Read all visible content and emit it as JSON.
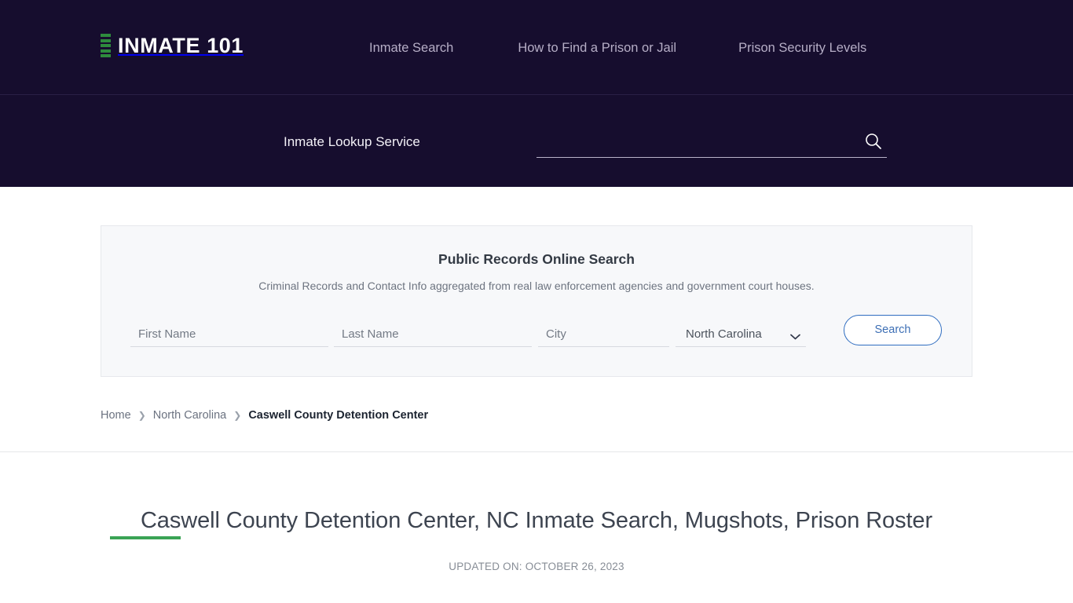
{
  "colors": {
    "header_bg": "#160d2e",
    "nav_text": "#b6aec6",
    "accent_green": "#3aa355",
    "button_blue": "#2f6dc0",
    "panel_bg": "#f7f8fa"
  },
  "header": {
    "logo": {
      "text": "INMATE 101",
      "mark_icon": "stacked-bars-icon",
      "mark_bar_count": 5
    },
    "nav": [
      {
        "label": "Inmate Search"
      },
      {
        "label": "How to Find a Prison or Jail"
      },
      {
        "label": "Prison Security Levels"
      }
    ]
  },
  "lookup": {
    "label": "Inmate Lookup Service",
    "input_value": "",
    "input_placeholder": "",
    "search_icon": "search-icon"
  },
  "public_records": {
    "title": "Public Records Online Search",
    "subtitle": "Criminal Records and Contact Info aggregated from real law enforcement agencies and government court houses.",
    "fields": {
      "first_name": {
        "placeholder": "First Name",
        "value": ""
      },
      "last_name": {
        "placeholder": "Last Name",
        "value": ""
      },
      "city": {
        "placeholder": "City",
        "value": ""
      },
      "state": {
        "selected": "North Carolina",
        "chevron_icon": "chevron-down-icon"
      }
    },
    "search_button": "Search"
  },
  "breadcrumb": {
    "items": [
      {
        "label": "Home",
        "current": false
      },
      {
        "label": "North Carolina",
        "current": false
      },
      {
        "label": "Caswell County Detention Center",
        "current": true
      }
    ],
    "separator": "❯"
  },
  "page": {
    "title": "Caswell County Detention Center, NC Inmate Search, Mugshots, Prison Roster",
    "updated": "UPDATED ON: OCTOBER 26, 2023"
  }
}
